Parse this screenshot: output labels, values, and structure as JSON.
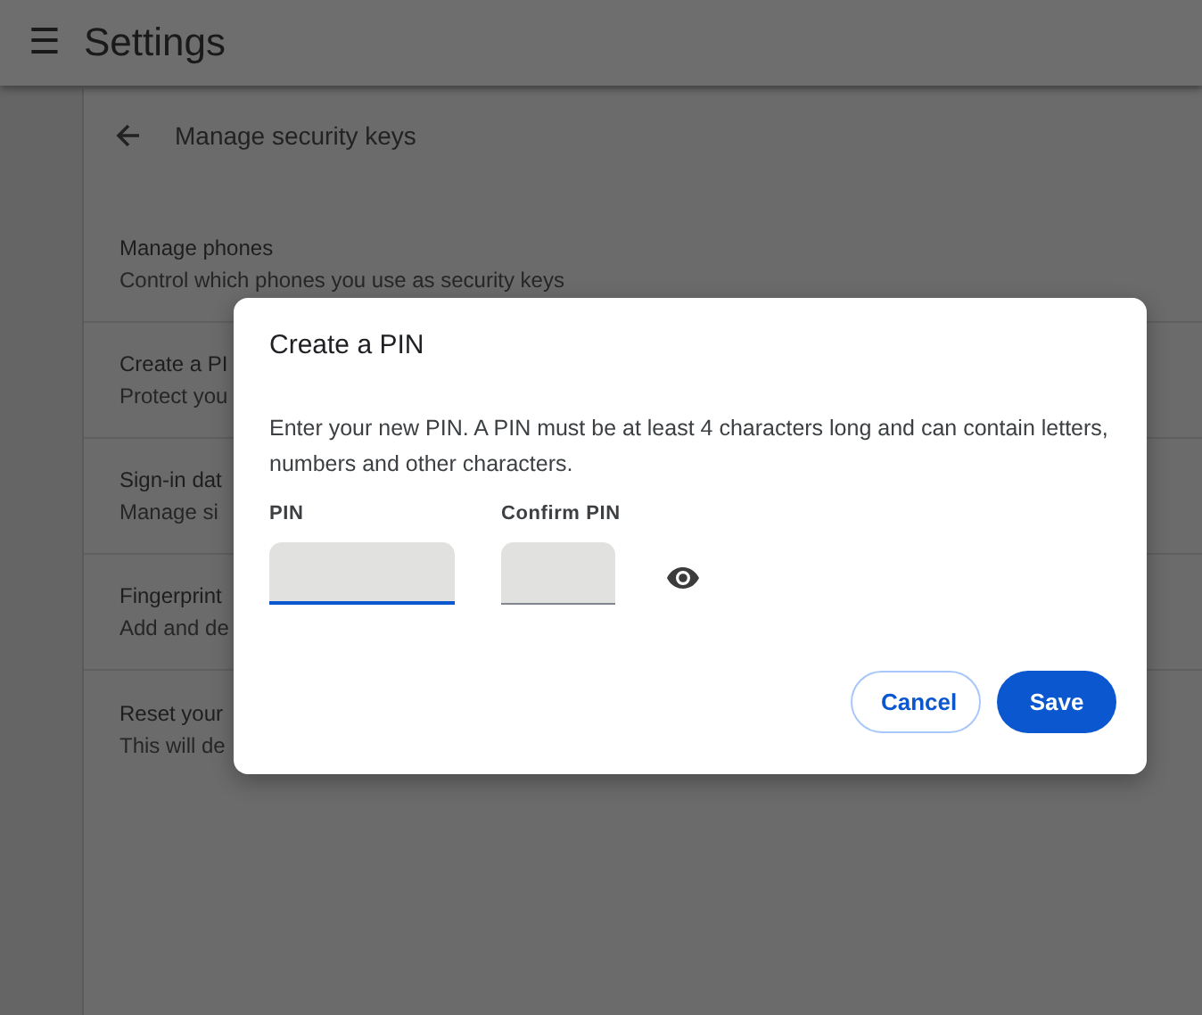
{
  "app_bar": {
    "menu_icon": "☰",
    "title": "Settings"
  },
  "subpage": {
    "title": "Manage security keys",
    "items": [
      {
        "title": "Manage phones",
        "subtitle": "Control which phones you use as security keys"
      },
      {
        "title": "Create a PI",
        "subtitle": "Protect you"
      },
      {
        "title": "Sign-in dat",
        "subtitle": "Manage si"
      },
      {
        "title": "Fingerprint",
        "subtitle": "Add and de"
      },
      {
        "title": "Reset your",
        "subtitle": "This will de"
      }
    ]
  },
  "dialog": {
    "title": "Create a PIN",
    "body": "Enter your new PIN. A PIN must be at least 4 characters long and can contain letters, numbers and other characters.",
    "fields": [
      {
        "label": "PIN",
        "focused": true
      },
      {
        "label": "Confirm PIN",
        "focused": false
      }
    ],
    "buttons": [
      {
        "label": "Cancel",
        "kind": "secondary"
      },
      {
        "label": "Save",
        "kind": "primary"
      }
    ]
  }
}
